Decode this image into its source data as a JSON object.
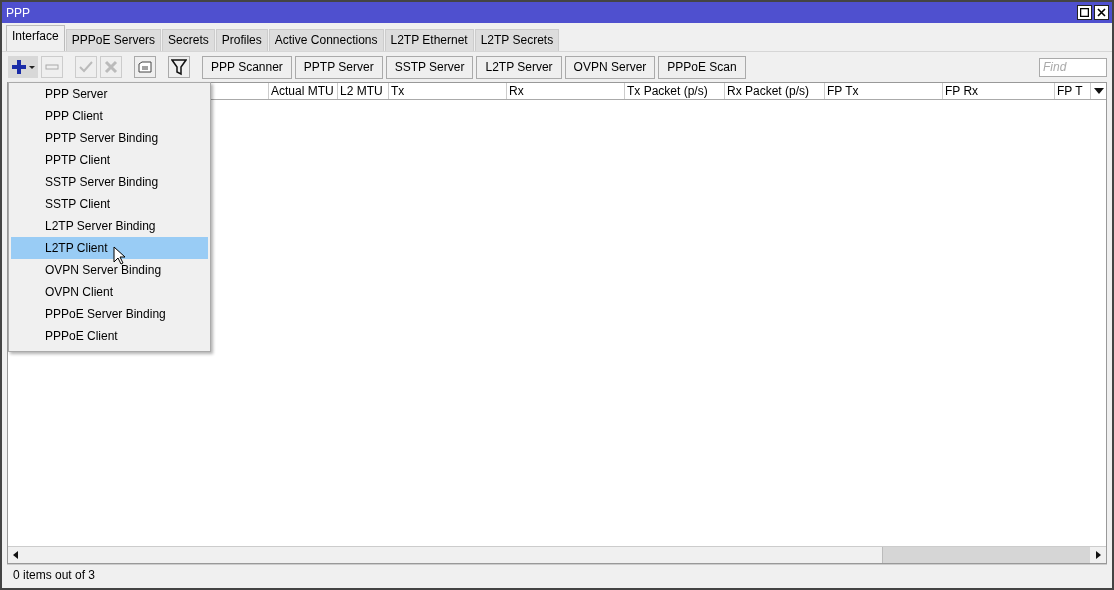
{
  "window": {
    "title": "PPP"
  },
  "tabs": [
    {
      "label": "Interface",
      "selected": true
    },
    {
      "label": "PPPoE Servers",
      "selected": false
    },
    {
      "label": "Secrets",
      "selected": false
    },
    {
      "label": "Profiles",
      "selected": false
    },
    {
      "label": "Active Connections",
      "selected": false
    },
    {
      "label": "L2TP Ethernet",
      "selected": false
    },
    {
      "label": "L2TP Secrets",
      "selected": false
    }
  ],
  "toolbar": {
    "icons": [
      {
        "kind": "add",
        "disabled": false
      },
      {
        "kind": "remove",
        "disabled": true
      },
      {
        "kind": "enable",
        "disabled": true
      },
      {
        "kind": "disable",
        "disabled": true
      },
      {
        "kind": "comment",
        "disabled": false
      },
      {
        "kind": "filter",
        "disabled": false
      }
    ],
    "buttons": [
      "PPP Scanner",
      "PPTP Server",
      "SSTP Server",
      "L2TP Server",
      "OVPN Server",
      "PPPoE Scan"
    ],
    "search": {
      "placeholder": "Find"
    }
  },
  "table": {
    "columns": [
      "Actual MTU",
      "L2 MTU",
      "Tx",
      "Rx",
      "Tx Packet (p/s)",
      "Rx Packet (p/s)",
      "FP Tx",
      "FP Rx",
      "FP T"
    ]
  },
  "add_menu": {
    "items": [
      {
        "label": "PPP Server",
        "selected": false
      },
      {
        "label": "PPP Client",
        "selected": false
      },
      {
        "label": "PPTP Server Binding",
        "selected": false
      },
      {
        "label": "PPTP Client",
        "selected": false
      },
      {
        "label": "SSTP Server Binding",
        "selected": false
      },
      {
        "label": "SSTP Client",
        "selected": false
      },
      {
        "label": "L2TP Server Binding",
        "selected": false
      },
      {
        "label": "L2TP Client",
        "selected": true
      },
      {
        "label": "OVPN Server Binding",
        "selected": false
      },
      {
        "label": "OVPN Client",
        "selected": false
      },
      {
        "label": "PPPoE Server Binding",
        "selected": false
      },
      {
        "label": "PPPoE Client",
        "selected": false
      }
    ]
  },
  "status_bar": {
    "text": "0 items out of 3"
  }
}
